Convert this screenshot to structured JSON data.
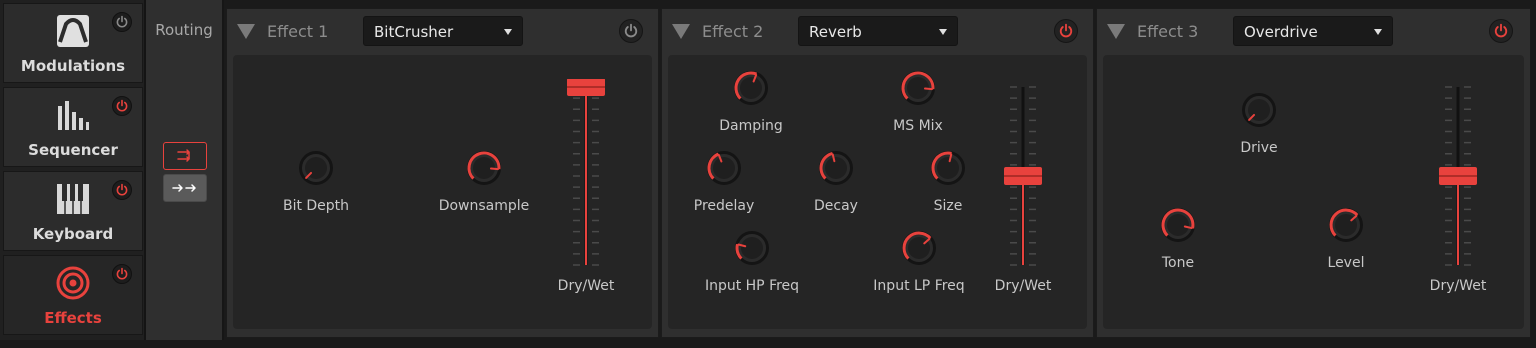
{
  "nav": {
    "items": [
      {
        "label": "Modulations",
        "icon": "modulation-envelope-icon",
        "power_on": false,
        "active": false
      },
      {
        "label": "Sequencer",
        "icon": "sequencer-bars-icon",
        "power_on": true,
        "active": false
      },
      {
        "label": "Keyboard",
        "icon": "keyboard-icon",
        "power_on": true,
        "active": false
      },
      {
        "label": "Effects",
        "icon": "effects-target-icon",
        "power_on": true,
        "active": true
      }
    ]
  },
  "routing": {
    "label": "Routing",
    "serial_icon": "routing-serial-icon",
    "parallel_icon": "routing-parallel-icon",
    "selected": "serial"
  },
  "colors": {
    "accent": "#e8423d",
    "inactive_power": "#8a8a8a",
    "knob_track": "#141414"
  },
  "effects": [
    {
      "title": "Effect 1",
      "type": "BitCrusher",
      "power_on": false,
      "knobs": [
        {
          "label": "Bit Depth",
          "value": 0.0
        },
        {
          "label": "Downsample",
          "value": 0.85
        }
      ],
      "fader": {
        "label": "Dry/Wet",
        "value": 1.0
      }
    },
    {
      "title": "Effect 2",
      "type": "Reverb",
      "power_on": true,
      "knobs": [
        {
          "label": "Damping",
          "value": 0.58
        },
        {
          "label": "MS Mix",
          "value": 0.85
        },
        {
          "label": "Predelay",
          "value": 0.42
        },
        {
          "label": "Decay",
          "value": 0.45
        },
        {
          "label": "Size",
          "value": 0.55
        },
        {
          "label": "Input HP Freq",
          "value": 0.22
        },
        {
          "label": "Input LP Freq",
          "value": 0.68
        }
      ],
      "fader": {
        "label": "Dry/Wet",
        "value": 0.5
      }
    },
    {
      "title": "Effect 3",
      "type": "Overdrive",
      "power_on": true,
      "knobs": [
        {
          "label": "Drive",
          "value": 0.0
        },
        {
          "label": "Tone",
          "value": 0.88
        },
        {
          "label": "Level",
          "value": 0.68
        }
      ],
      "fader": {
        "label": "Dry/Wet",
        "value": 0.5
      }
    }
  ]
}
